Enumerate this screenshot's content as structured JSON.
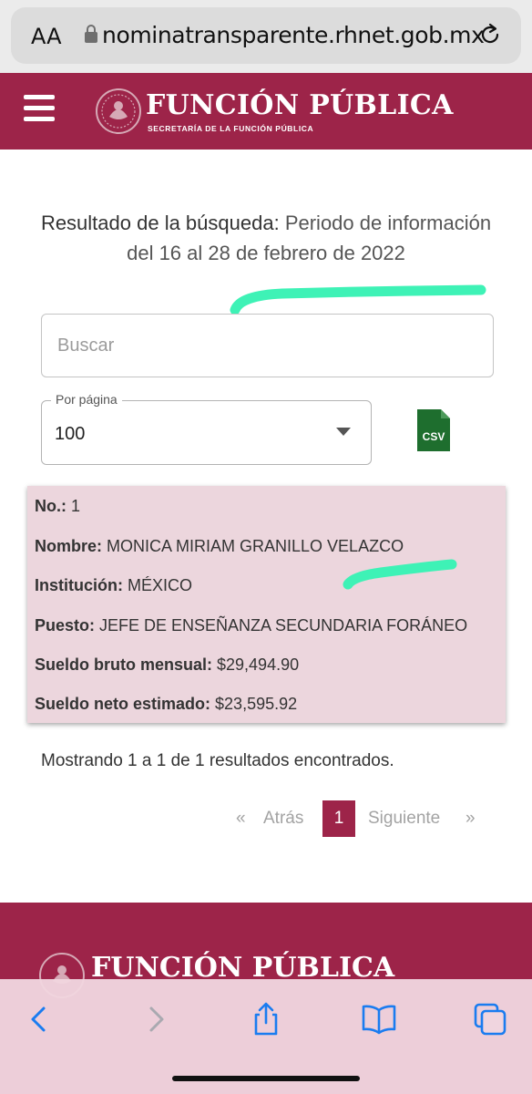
{
  "browser": {
    "aa_label": "AA",
    "url": "nominatransparente.rhnet.gob.mx"
  },
  "header": {
    "brand": "FUNCIÓN PÚBLICA",
    "brand_sub": "SECRETARÍA DE LA FUNCIÓN PÚBLICA"
  },
  "title": {
    "bold": "Resultado de la búsqueda:",
    "rest": " Periodo de información del 16 al 28 de febrero de 2022"
  },
  "search": {
    "placeholder": "Buscar",
    "value": ""
  },
  "per_page": {
    "label": "Por página",
    "value": "100"
  },
  "csv_label": "CSV",
  "result": {
    "no_label": "No.:",
    "no_value": " 1",
    "nombre_label": "Nombre:",
    "nombre_value": " MONICA MIRIAM GRANILLO VELAZCO",
    "institucion_label": "Institución:",
    "institucion_value": " MÉXICO",
    "puesto_label": "Puesto:",
    "puesto_value": " JEFE DE ENSEÑANZA SECUNDARIA FORÁNEO",
    "bruto_label": "Sueldo bruto mensual:",
    "bruto_value": " $29,494.90",
    "neto_label": "Sueldo neto estimado:",
    "neto_value": " $23,595.92"
  },
  "showing": "Mostrando 1 a 1 de 1 resultados encontrados.",
  "pagination": {
    "first": "«",
    "prev": "Atrás",
    "current": "1",
    "next": "Siguiente",
    "last": "»"
  },
  "footer": {
    "brand": "FUNCIÓN PÚBLICA"
  },
  "colors": {
    "brand": "#9d2449",
    "marker": "#3ef2b6",
    "card": "#ecd6dd",
    "toolbar_icon": "#1a7cf0",
    "csv_green": "#1e6e2e"
  },
  "icons": [
    "lock-icon",
    "reload-icon",
    "menu-icon",
    "seal-icon",
    "caret-down-icon",
    "csv-icon",
    "back-icon",
    "forward-icon",
    "share-icon",
    "bookmarks-icon",
    "tabs-icon"
  ]
}
